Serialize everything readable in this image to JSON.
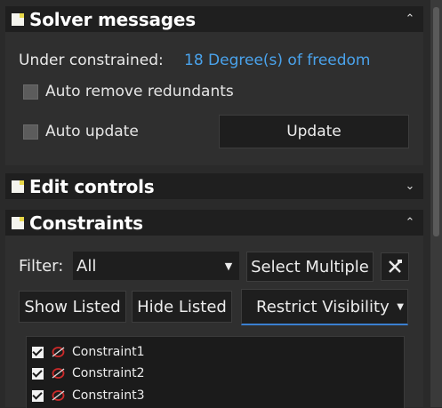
{
  "solver": {
    "title": "Solver messages",
    "status_label": "Under constrained:",
    "status_link": "18 Degree(s) of freedom",
    "auto_remove_label": "Auto remove redundants",
    "auto_update_label": "Auto update",
    "update_button": "Update",
    "chevron": "up-chevron"
  },
  "edit_controls": {
    "title": "Edit controls",
    "chevron": "down-chevron"
  },
  "constraints": {
    "title": "Constraints",
    "chevron": "up-chevron",
    "filter_label": "Filter:",
    "filter_value": "All",
    "select_multiple_button": "Select Multiple",
    "settings_icon": "tools-icon",
    "show_listed_button": "Show Listed",
    "hide_listed_button": "Hide Listed",
    "restrict_visibility_button": "Restrict Visibility",
    "items": [
      {
        "label": "Constraint1",
        "checked": true
      },
      {
        "label": "Constraint2",
        "checked": true
      },
      {
        "label": "Constraint3",
        "checked": true
      }
    ]
  },
  "colors": {
    "link": "#4aa3ec",
    "header_bg": "#1f1f1f",
    "body_bg": "#2f2f2f"
  }
}
